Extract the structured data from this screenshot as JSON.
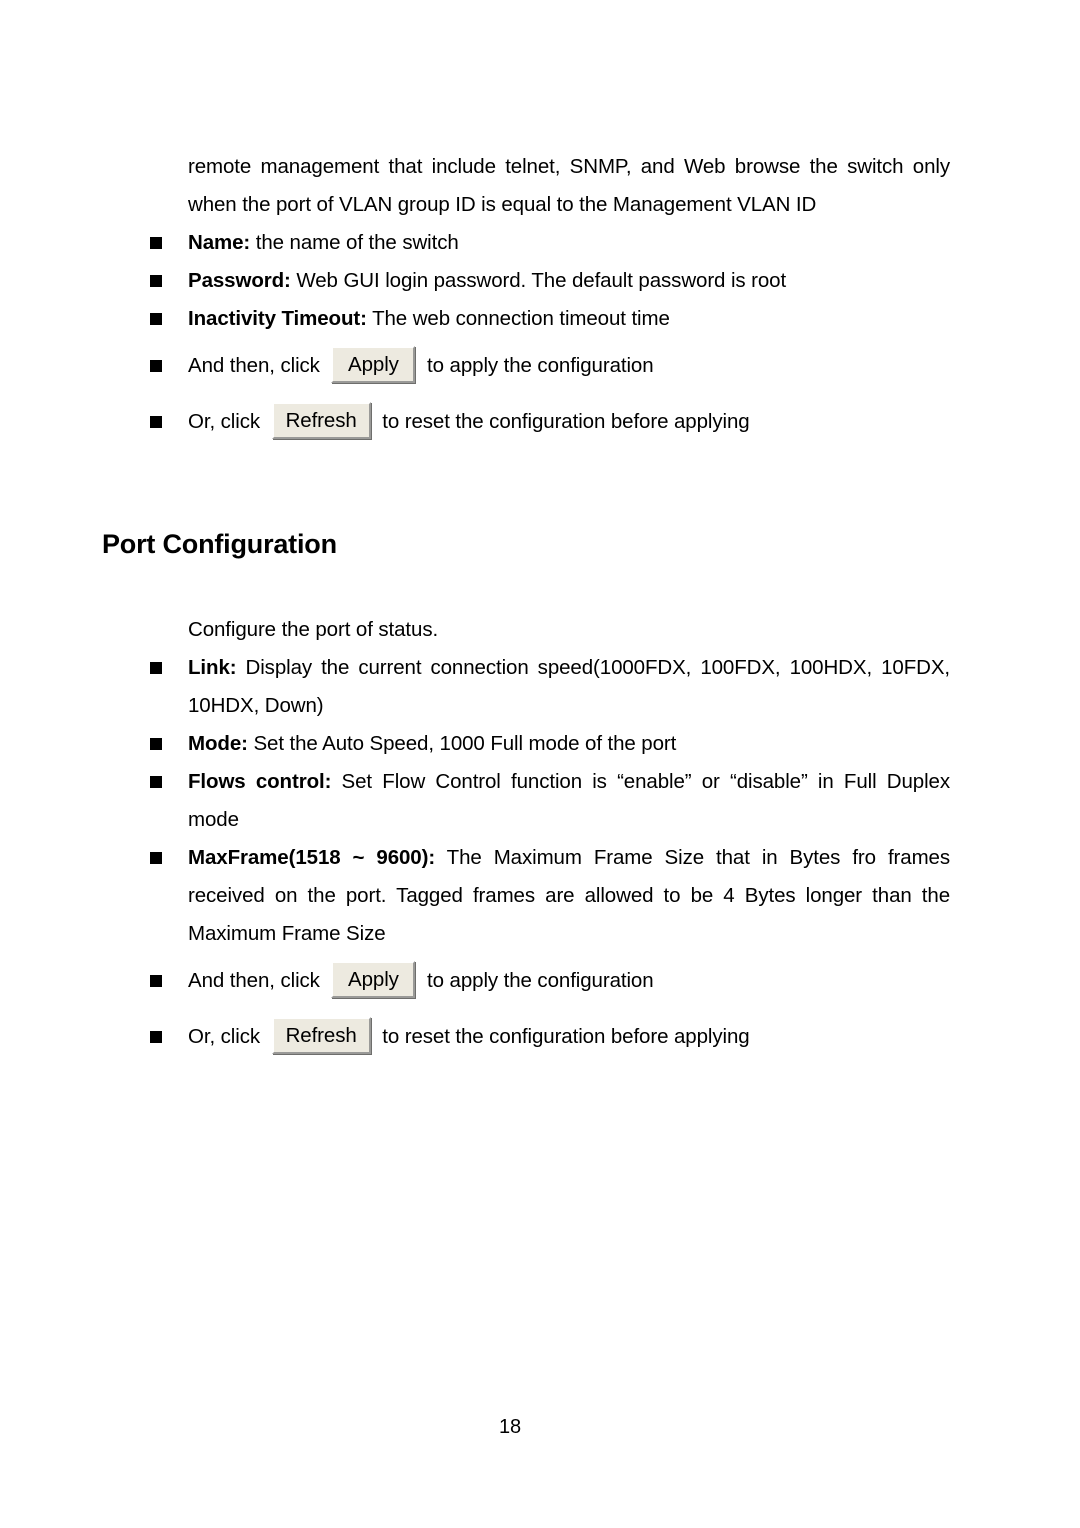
{
  "document": {
    "page_number": "18",
    "bullet_glyph": "■",
    "colors": {
      "page_background": "#ffffff",
      "text": "#000000",
      "button_face": "#EDEAE0",
      "button_highlight": "#FFFFFF",
      "button_shadow": "#9A9A98",
      "button_outer_shadow": "#6E6E6C"
    }
  },
  "section_one": {
    "intro_paragraph": "remote management that include telnet, SNMP, and Web browse the switch only when the port of VLAN group ID is equal to the Management VLAN ID",
    "bullets": [
      {
        "term": "Name:",
        "text": " the name of the switch"
      },
      {
        "term": "Password:",
        "text": " Web GUI login password. The default password is root"
      },
      {
        "term": "Inactivity Timeout:",
        "text": " The web connection timeout time"
      }
    ],
    "apply_bullet": {
      "lead_text": "And then, click",
      "button_label": "Apply",
      "trail_text": "to apply the configuration"
    },
    "refresh_bullet": {
      "lead_text": "Or, click",
      "button_label": "Refresh",
      "trail_text": "to reset the configuration before applying"
    }
  },
  "heading": {
    "title": "Port Configuration"
  },
  "section_two": {
    "intro_paragraph": "Configure the port of status.",
    "bullets": [
      {
        "term": "Link:",
        "text": " Display the current connection speed(1000FDX, 100FDX, 100HDX, 10FDX, 10HDX, Down)"
      },
      {
        "term": "Mode:",
        "text": " Set the Auto Speed, 1000 Full mode of the port"
      },
      {
        "term": "Flows control:",
        "text": " Set Flow Control function is “enable” or “disable” in Full Duplex mode"
      },
      {
        "term": "MaxFrame(1518 ~ 9600):",
        "text": " The Maximum Frame Size that in Bytes fro frames received on the port. Tagged frames are allowed to be 4 Bytes longer than the Maximum Frame Size"
      }
    ],
    "apply_bullet": {
      "lead_text": "And then, click",
      "button_label": "Apply",
      "trail_text": "to apply the configuration"
    },
    "refresh_bullet": {
      "lead_text": "Or, click",
      "button_label": "Refresh",
      "trail_text": "to reset the configuration before applying"
    }
  }
}
